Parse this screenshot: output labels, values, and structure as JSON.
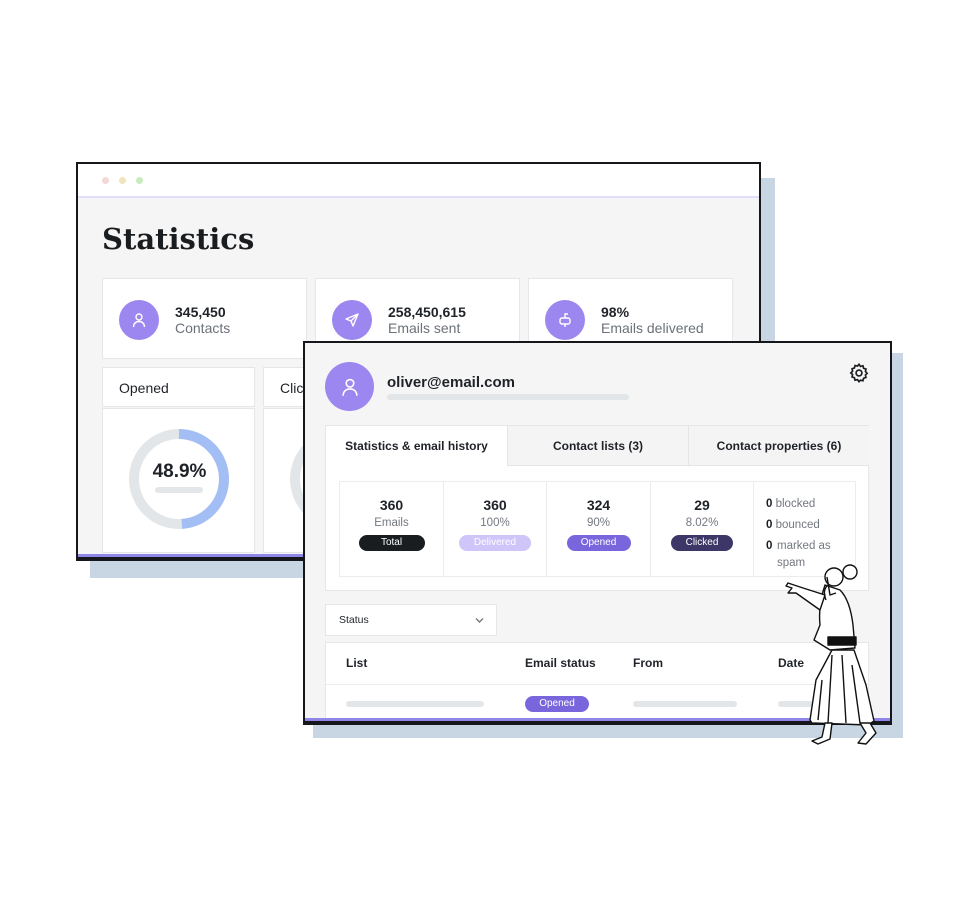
{
  "stats_window": {
    "title": "Statistics",
    "cards": [
      {
        "value": "345,450",
        "label": "Contacts",
        "icon": "user-icon"
      },
      {
        "value": "258,450,615",
        "label": "Emails sent",
        "icon": "send-icon"
      },
      {
        "value": "98%",
        "label": "Emails delivered",
        "icon": "mailbox-icon"
      }
    ],
    "charts": [
      {
        "label": "Opened",
        "value": "48.9%",
        "percent": 48.9
      },
      {
        "label": "Clicked",
        "visible_label": "Clic"
      }
    ],
    "colors": {
      "accent": "#9b87ef",
      "donut_fill": "#a3bef5",
      "donut_track": "#e3e6e8"
    }
  },
  "contact_window": {
    "email": "oliver@email.com",
    "settings_icon": "gear-icon",
    "tabs": [
      {
        "label": "Statistics & email history",
        "active": true
      },
      {
        "label": "Contact lists (3)"
      },
      {
        "label": "Contact properties (6)"
      }
    ],
    "stats": [
      {
        "value": "360",
        "sub": "Emails",
        "badge": "Total",
        "color": "#1a1d20"
      },
      {
        "value": "360",
        "sub": "100%",
        "badge": "Delivered",
        "color": "#cfc5f8"
      },
      {
        "value": "324",
        "sub": "90%",
        "badge": "Opened",
        "color": "#7a66dc"
      },
      {
        "value": "29",
        "sub": "8.02%",
        "badge": "Clicked",
        "color": "#3c3766"
      }
    ],
    "other": [
      {
        "count": "0",
        "label": "blocked"
      },
      {
        "count": "0",
        "label": "bounced"
      },
      {
        "count": "0",
        "label": "marked as spam"
      }
    ],
    "filter": {
      "label": "Status"
    },
    "table": {
      "columns": [
        "List",
        "Email status",
        "From",
        "Date"
      ],
      "rows": [
        {
          "status": "Opened"
        }
      ]
    }
  }
}
